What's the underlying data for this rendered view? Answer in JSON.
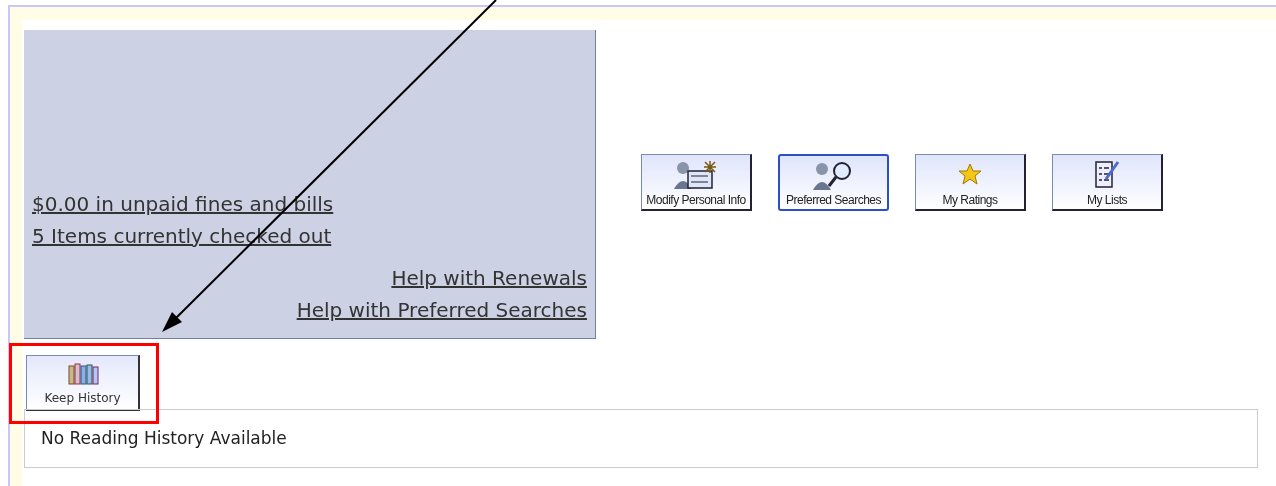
{
  "account_panel": {
    "links": [
      {
        "label": "$0.00 in unpaid fines and bills",
        "kind": "summary"
      },
      {
        "label": "5 Items currently checked out",
        "kind": "summary"
      },
      {
        "label": "Help with Renewals",
        "kind": "help"
      },
      {
        "label": "Help with Preferred Searches",
        "kind": "help"
      }
    ]
  },
  "toolbar": [
    {
      "kind": "person-form",
      "label": "Modify Personal Info",
      "selected": false
    },
    {
      "kind": "person-search",
      "label": "Preferred Searches",
      "selected": true
    },
    {
      "kind": "star",
      "label": "My Ratings",
      "selected": false
    },
    {
      "kind": "checklist",
      "label": "My Lists",
      "selected": false
    }
  ],
  "history_button": {
    "label": "Keep History"
  },
  "reading_history": {
    "message": "No Reading History Available"
  }
}
